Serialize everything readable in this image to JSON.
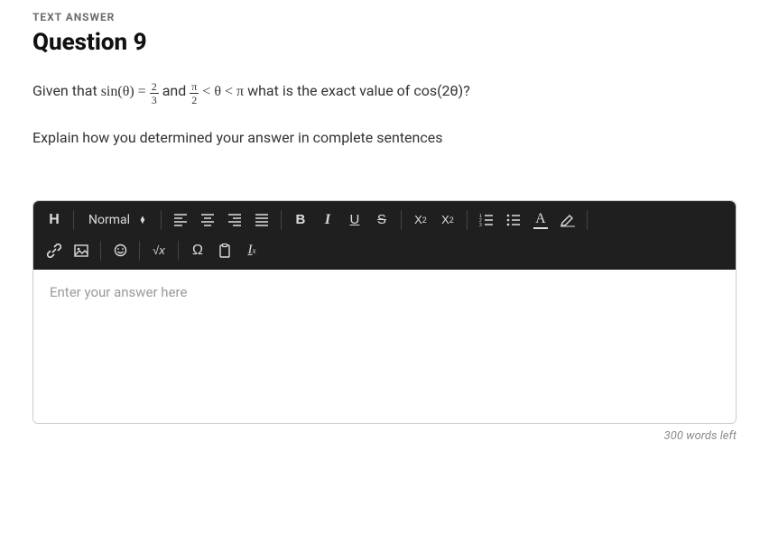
{
  "label": "TEXT ANSWER",
  "title": "Question 9",
  "prompt": {
    "lead": "Given that ",
    "eq1_lhs": "sin(θ) = ",
    "eq1_num": "2",
    "eq1_den": "3",
    "mid": " and ",
    "eq2_num": "π",
    "eq2_den": "2",
    "eq2_rhs": " < θ < π",
    "tail": " what is the exact value of cos(2θ)?"
  },
  "explain": "Explain how you determined your answer in complete sentences",
  "toolbar": {
    "heading": "H",
    "style": "Normal",
    "bold": "B",
    "italic": "I",
    "underline": "U",
    "strike": "S",
    "subscript_base": "X",
    "subscript_sub": "2",
    "superscript_base": "X",
    "superscript_sup": "2",
    "textcolor": "A",
    "sqrt": "√x",
    "omega": "Ω",
    "clear_sub": "x"
  },
  "editor": {
    "placeholder": "Enter your answer here"
  },
  "wordcount": "300 words left"
}
